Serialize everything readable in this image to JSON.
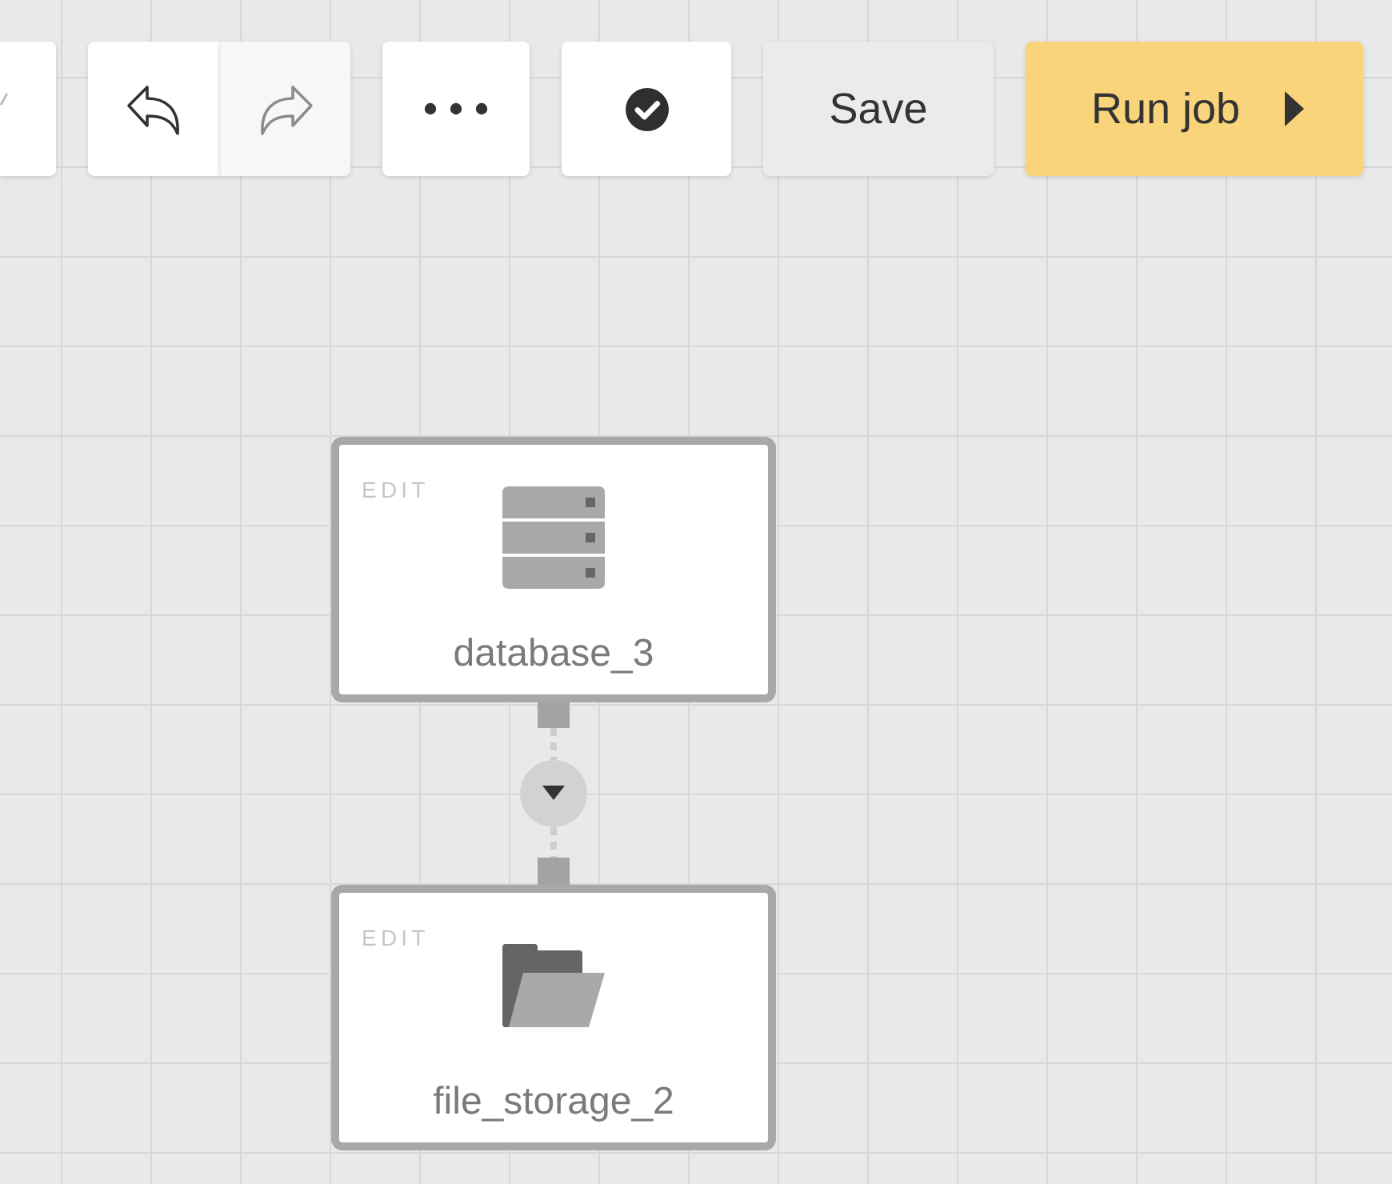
{
  "toolbar": {
    "items": [
      {
        "kind": "cut_off"
      },
      {
        "kind": "history",
        "buttons": [
          {
            "kind": "undo",
            "disabled": false
          },
          {
            "kind": "redo",
            "disabled": true
          }
        ]
      },
      {
        "kind": "more"
      },
      {
        "kind": "validate"
      },
      {
        "kind": "save",
        "label": "Save"
      },
      {
        "kind": "run",
        "label": "Run job"
      }
    ]
  },
  "canvas": {
    "nodes": [
      {
        "kind": "database",
        "edit": "EDIT",
        "name": "database_3",
        "has_output": true
      },
      {
        "kind": "file_storage",
        "edit": "EDIT",
        "name": "file_storage_2",
        "has_output": false
      }
    ]
  }
}
